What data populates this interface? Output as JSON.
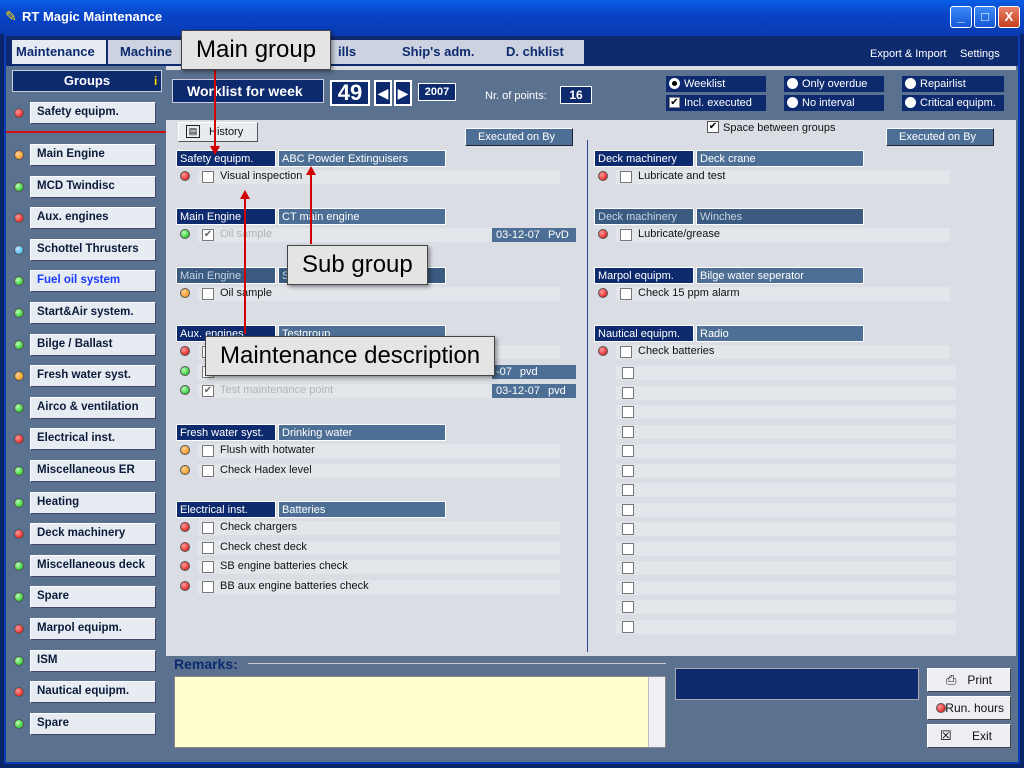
{
  "window": {
    "title": "RT Magic Maintenance",
    "minimize": "_",
    "maximize": "□",
    "close": "X"
  },
  "tabs": [
    {
      "label": "Maintenance"
    },
    {
      "label": "Machine"
    },
    {
      "label": "ills"
    },
    {
      "label": "Ship's adm."
    },
    {
      "label": "D. chklist"
    }
  ],
  "toplinks": {
    "export": "Export & Import",
    "settings": "Settings"
  },
  "sidebar": {
    "header": "Groups",
    "info": "i",
    "items": [
      {
        "label": "Safety equipm.",
        "status": "red"
      },
      {
        "label": "Main Engine",
        "status": "orange"
      },
      {
        "label": "MCD Twindisc",
        "status": "green"
      },
      {
        "label": "Aux. engines",
        "status": "red"
      },
      {
        "label": "Schottel Thrusters",
        "status": "blue"
      },
      {
        "label": "Fuel oil system",
        "status": "green"
      },
      {
        "label": "Start&Air system.",
        "status": "green"
      },
      {
        "label": "Bilge / Ballast",
        "status": "green"
      },
      {
        "label": "Fresh water syst.",
        "status": "orange"
      },
      {
        "label": "Airco & ventilation",
        "status": "green"
      },
      {
        "label": "Electrical inst.",
        "status": "red"
      },
      {
        "label": "Miscellaneous ER",
        "status": "green"
      },
      {
        "label": "Heating",
        "status": "green"
      },
      {
        "label": "Deck machinery",
        "status": "red"
      },
      {
        "label": "Miscellaneous deck",
        "status": "green"
      },
      {
        "label": "Spare",
        "status": "green"
      },
      {
        "label": "Marpol equipm.",
        "status": "red"
      },
      {
        "label": "ISM",
        "status": "green"
      },
      {
        "label": "Nautical equipm.",
        "status": "red"
      },
      {
        "label": "Spare",
        "status": "green"
      }
    ],
    "bottom_info": "i"
  },
  "worklist": {
    "label": "Worklist for week",
    "week": "49",
    "prev": "◀",
    "next": "▶",
    "year": "2007",
    "nr_points_label": "Nr. of points:",
    "nr_points": "16"
  },
  "options": {
    "weeklist": "Weeklist",
    "only_overdue": "Only overdue",
    "repairlist": "Repairlist",
    "incl_executed": "Incl. executed",
    "no_interval": "No interval",
    "critical": "Critical equipm."
  },
  "history_label": "History",
  "space_between_groups": "Space between groups",
  "executed_header": "Executed on   By",
  "left_groups": [
    {
      "main": "Safety equipm.",
      "sub": "ABC Powder Extinguisers",
      "items": [
        {
          "text": "Visual inspection",
          "status": "red",
          "checked": false
        }
      ]
    },
    {
      "main": "Main Engine",
      "sub": "CT main engine",
      "items": [
        {
          "text": "Oil sample",
          "status": "green",
          "checked": true,
          "date": "03-12-07",
          "by": "PvD"
        }
      ]
    },
    {
      "main": "Main Engine",
      "sub": "S",
      "items": [
        {
          "text": "Oil sample",
          "status": "orange",
          "checked": false
        }
      ]
    },
    {
      "main": "Aux. engines",
      "sub": "Testgroup",
      "items": [
        {
          "text": "",
          "status": "red",
          "checked": false
        },
        {
          "text": "",
          "status": "green",
          "checked": true,
          "date": "-07",
          "by": "pvd"
        },
        {
          "text": "Test maintenance point",
          "status": "green",
          "checked": true,
          "date": "03-12-07",
          "by": "pvd"
        }
      ]
    },
    {
      "main": "Fresh water syst.",
      "sub": "Drinking water",
      "items": [
        {
          "text": "Flush with hotwater",
          "status": "orange",
          "checked": false
        },
        {
          "text": "Check Hadex level",
          "status": "orange",
          "checked": false
        }
      ]
    },
    {
      "main": "Electrical inst.",
      "sub": "Batteries",
      "items": [
        {
          "text": "Check chargers",
          "status": "red",
          "checked": false
        },
        {
          "text": "Check chest deck",
          "status": "red",
          "checked": false
        },
        {
          "text": "SB engine batteries check",
          "status": "red",
          "checked": false
        },
        {
          "text": "BB aux engine batteries check",
          "status": "red",
          "checked": false
        }
      ]
    }
  ],
  "right_groups": [
    {
      "main": "Deck machinery",
      "sub": "Deck crane",
      "items": [
        {
          "text": "Lubricate and test",
          "status": "red",
          "checked": false
        }
      ]
    },
    {
      "main": "Deck machinery",
      "sub": "Winches",
      "items": [
        {
          "text": "Lubricate/grease",
          "status": "red",
          "checked": false
        }
      ]
    },
    {
      "main": "Marpol equipm.",
      "sub": "Bilge water seperator",
      "items": [
        {
          "text": "Check 15 ppm alarm",
          "status": "red",
          "checked": false
        }
      ]
    },
    {
      "main": "Nautical equipm.",
      "sub": "Radio",
      "items": [
        {
          "text": "Check batteries",
          "status": "red",
          "checked": false
        }
      ]
    }
  ],
  "remarks": {
    "label": "Remarks:",
    "value": ""
  },
  "buttons": {
    "print": "Print",
    "run_hours": "Run. hours",
    "exit": "Exit"
  },
  "callouts": {
    "main_group": "Main group",
    "sub_group": "Sub group",
    "maintenance_description": "Maintenance description"
  }
}
